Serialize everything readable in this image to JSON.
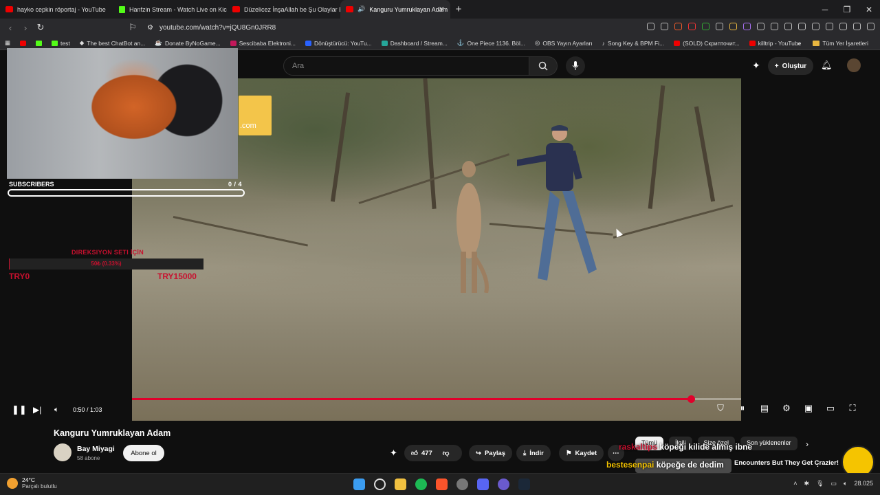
{
  "browser": {
    "tabs": [
      {
        "title": "hayko cepkin röportaj - YouTube",
        "favicon": "youtube-icon"
      },
      {
        "title": "Hanfzin Stream - Watch Live on Kick",
        "favicon": "kick-icon"
      },
      {
        "title": "Düzelicez İnşaAllah be Şu Olaylar Bi",
        "favicon": "youtube-icon"
      },
      {
        "title": "Kanguru Yumruklayan Adam",
        "favicon": "youtube-icon",
        "active": true,
        "audio": true
      }
    ],
    "url": "youtube.com/watch?v=jQU8Gn0JRR8",
    "bookmarks": [
      {
        "label": "test",
        "icon": "kick-icon"
      },
      {
        "label": "The best ChatBot an...",
        "icon": "chatbot-icon"
      },
      {
        "label": "Donate ByNoGame...",
        "icon": "donate-icon"
      },
      {
        "label": "Sescibaba Elektroni...",
        "icon": "sescibaba-icon"
      },
      {
        "label": "Dönüştürücü: YouTu...",
        "icon": "converter-icon"
      },
      {
        "label": "Dashboard / Stream...",
        "icon": "dashboard-icon"
      },
      {
        "label": "One Piece 1136. Böl...",
        "icon": "onepiece-icon"
      },
      {
        "label": "OBS Yayın Ayarları",
        "icon": "obs-icon"
      },
      {
        "label": "Song Key & BPM Fi...",
        "icon": "song-icon"
      },
      {
        "label": "(SOLD) Скрипточит...",
        "icon": "youtube-icon"
      },
      {
        "label": "killtrip - YouTube",
        "icon": "youtube-icon"
      }
    ],
    "bookmarks_all": "Tüm Yer İşaretleri"
  },
  "youtube": {
    "search_placeholder": "Ara",
    "create_label": "Oluştur",
    "video": {
      "title": "Kanguru Yumruklayan Adam",
      "time": "0:50 / 1:03",
      "progress_fraction": 0.795
    },
    "channel": {
      "name": "Bay Miyagi",
      "subs": "58 abone",
      "subscribe_label": "Abone ol"
    },
    "actions": {
      "likes": "477",
      "share": "Paylaş",
      "download": "İndir",
      "save": "Kaydet"
    },
    "chips": [
      "Tümü",
      "İlgili",
      "Size özel",
      "Son yüklenenler"
    ],
    "recommended_title": "Encounters But They Get Crazier!"
  },
  "overlays": {
    "subscribers_label": "SUBSCRIBERS",
    "subscribers_count": "0 / 4",
    "goal_title": "DIREKSIYON SETI İÇİN",
    "goal_progress_text": "50₺ (0.33%)",
    "goal_fraction": 0.0033,
    "goal_min": "TRY0",
    "goal_max": "TRY15000",
    "alert1_user": "raskaltips",
    "alert1_text": "köpeği kilide almış ibne",
    "alert2_user": "bestesenpai",
    "alert2_text": "köpeğe de dedim",
    "ad_text": ".com"
  },
  "taskbar": {
    "temperature": "24°C",
    "weather": "Parçalı bulutlu",
    "date_partial": "28.",
    "year_partial": "025"
  },
  "colors": {
    "accent": "#e0002b",
    "goal": "#c8102e"
  }
}
